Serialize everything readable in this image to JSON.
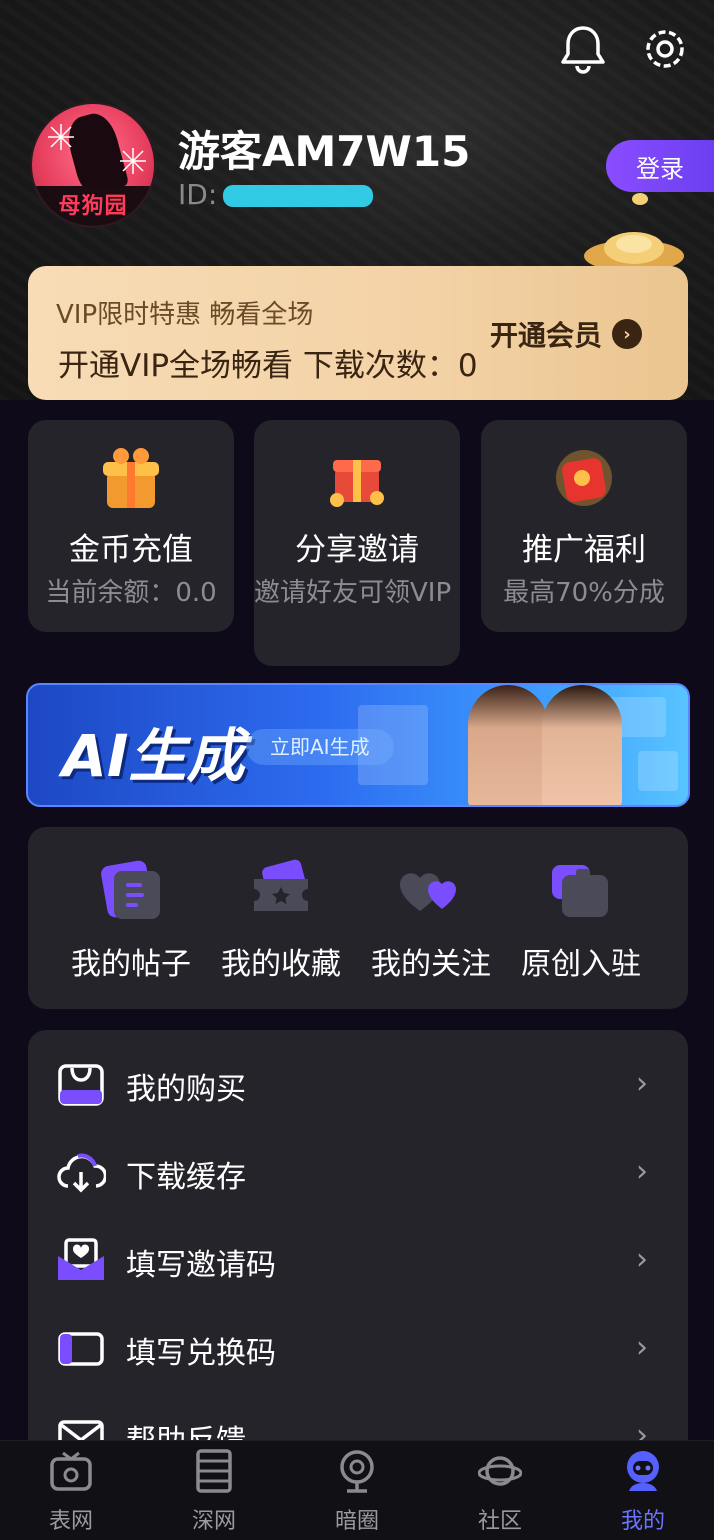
{
  "header": {
    "username": "游客AM7W15",
    "id_label": "ID:",
    "avatar_logo_text": "母狗园",
    "login_label": "登录"
  },
  "vip": {
    "title": "VIP限时特惠 畅看全场",
    "subtitle": "开通VIP全场畅看 下载次数：0",
    "open_label": "开通会员"
  },
  "features": [
    {
      "title": "金币充值",
      "subtitle": "当前余额：0.0",
      "icon": "gift-box-icon"
    },
    {
      "title": "分享邀请",
      "subtitle": "邀请好友可领VIP",
      "icon": "gift-coins-icon"
    },
    {
      "title": "推广福利",
      "subtitle": "最高70%分成",
      "icon": "red-envelope-icon"
    }
  ],
  "ai_banner": {
    "title": "AI生成",
    "button_label": "立即AI生成"
  },
  "quick_actions": [
    {
      "label": "我的帖子",
      "icon": "posts-icon"
    },
    {
      "label": "我的收藏",
      "icon": "star-ticket-icon"
    },
    {
      "label": "我的关注",
      "icon": "hearts-icon"
    },
    {
      "label": "原创入驻",
      "icon": "creator-bag-icon"
    }
  ],
  "menu": [
    {
      "label": "我的购买",
      "icon": "shopping-bag-icon"
    },
    {
      "label": "下载缓存",
      "icon": "cloud-download-icon"
    },
    {
      "label": "填写邀请码",
      "icon": "invite-envelope-icon"
    },
    {
      "label": "填写兑换码",
      "icon": "coupon-icon"
    },
    {
      "label": "帮助反馈",
      "icon": "mail-icon"
    }
  ],
  "tabs": [
    {
      "label": "表网",
      "icon": "tv-icon",
      "active": false
    },
    {
      "label": "深网",
      "icon": "film-icon",
      "active": false
    },
    {
      "label": "暗圈",
      "icon": "webcam-icon",
      "active": false
    },
    {
      "label": "社区",
      "icon": "planet-icon",
      "active": false
    },
    {
      "label": "我的",
      "icon": "profile-robot-icon",
      "active": true
    }
  ],
  "colors": {
    "accent": "#6a74ff",
    "login_purple": "#7b45f8",
    "vip_gold": "#f3d2a6",
    "card_bg": "#24242a",
    "page_bg": "#0e0a1a"
  }
}
